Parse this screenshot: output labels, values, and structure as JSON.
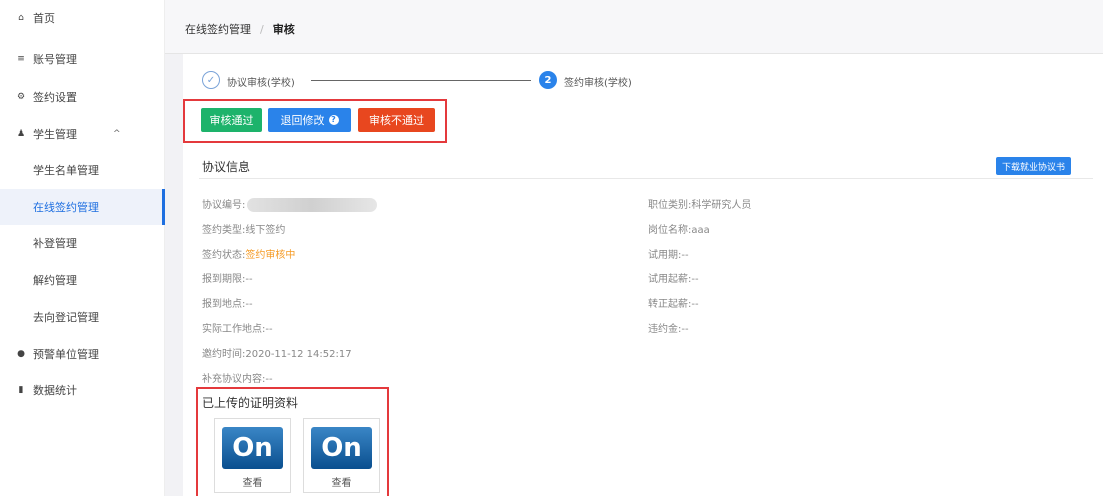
{
  "sidebar": {
    "items": [
      {
        "icon": "home-icon",
        "glyph": "⌂",
        "label": "首页"
      },
      {
        "icon": "list-icon",
        "glyph": "≡",
        "label": "账号管理"
      },
      {
        "icon": "gear-icon",
        "glyph": "⚙",
        "label": "签约设置"
      },
      {
        "icon": "user-icon",
        "glyph": "♟",
        "label": "学生管理"
      },
      {
        "label": "学生名单管理"
      },
      {
        "label": "在线签约管理"
      },
      {
        "label": "补登管理"
      },
      {
        "label": "解约管理"
      },
      {
        "label": "去向登记管理"
      },
      {
        "icon": "warning-icon",
        "glyph": "●",
        "label": "预警单位管理"
      },
      {
        "icon": "bar-chart-icon",
        "glyph": "▮",
        "label": "数据统计"
      }
    ],
    "expanded_chevron": "^"
  },
  "breadcrumb": {
    "parent": "在线签约管理",
    "separator": "/",
    "current": "审核"
  },
  "steps": [
    {
      "marker": "✓",
      "label": "协议审核(学校)"
    },
    {
      "marker": "2",
      "label": "签约审核(学校)"
    }
  ],
  "actions": {
    "approve": "审核通过",
    "return": "退回修改",
    "return_help": "?",
    "reject": "审核不通过"
  },
  "section": {
    "title": "协议信息",
    "download": "下载就业协议书"
  },
  "info_left": [
    {
      "label": "协议编号:",
      "value": ""
    },
    {
      "label": "签约类型:",
      "value": "线下签约"
    },
    {
      "label": "签约状态:",
      "value": "签约审核中"
    },
    {
      "label": "报到期限:",
      "value": "--"
    },
    {
      "label": "报到地点:",
      "value": "--"
    },
    {
      "label": "实际工作地点:",
      "value": "--"
    },
    {
      "label": "邀约时间:",
      "value": "2020-11-12 14:52:17"
    },
    {
      "label": "补充协议内容:",
      "value": "--"
    }
  ],
  "info_right": [
    {
      "label": "职位类别:",
      "value": "科学研究人员"
    },
    {
      "label": "岗位名称:",
      "value": "aaa"
    },
    {
      "label": "试用期:",
      "value": "--"
    },
    {
      "label": "试用起薪:",
      "value": "--"
    },
    {
      "label": "转正起薪:",
      "value": "--"
    },
    {
      "label": "违约金:",
      "value": "--"
    }
  ],
  "uploads": {
    "title": "已上传的证明资料",
    "files": [
      {
        "logo_text": "On",
        "caption": "查看"
      },
      {
        "logo_text": "On",
        "caption": "查看"
      }
    ]
  },
  "colors": {
    "primary": "#2a83ea",
    "approve": "#1db36b",
    "reject": "#e8471f",
    "highlight_box": "#e4393c",
    "status": "#f59a23"
  }
}
